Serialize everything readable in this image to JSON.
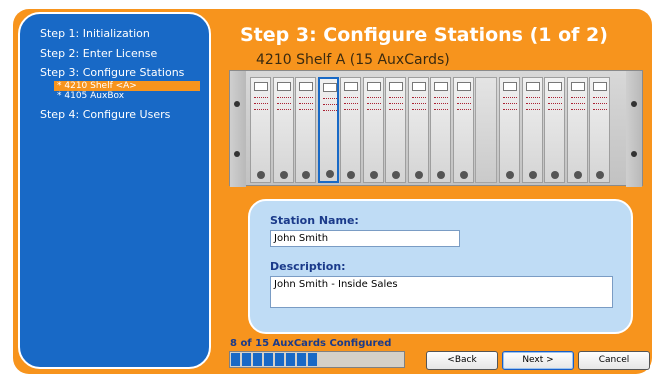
{
  "sidebar": {
    "items": [
      {
        "label": "Step 1: Initialization"
      },
      {
        "label": "Step 2: Enter License"
      },
      {
        "label": "Step 3: Configure Stations"
      },
      {
        "label": "Step 4: Configure Users"
      }
    ],
    "subitems": [
      {
        "label": "* 4210 Shelf <A>",
        "selected": true
      },
      {
        "label": "* 4105 AuxBox",
        "selected": false
      }
    ]
  },
  "main": {
    "title": "Step 3: Configure Stations (1 of 2)",
    "shelf_title": "4210 Shelf A (15 AuxCards)"
  },
  "form": {
    "station_name_label": "Station Name:",
    "station_name_value": "John Smith",
    "description_label": "Description:",
    "description_value": "John Smith - Inside Sales"
  },
  "progress": {
    "label": "8 of 15 AuxCards Configured",
    "configured": 8,
    "total": 15
  },
  "buttons": {
    "back": "<Back",
    "next": "Next >",
    "cancel": "Cancel"
  },
  "colors": {
    "accent_orange": "#f7941d",
    "sidebar_blue": "#1869c6",
    "panel_blue": "#bfdcf5"
  }
}
